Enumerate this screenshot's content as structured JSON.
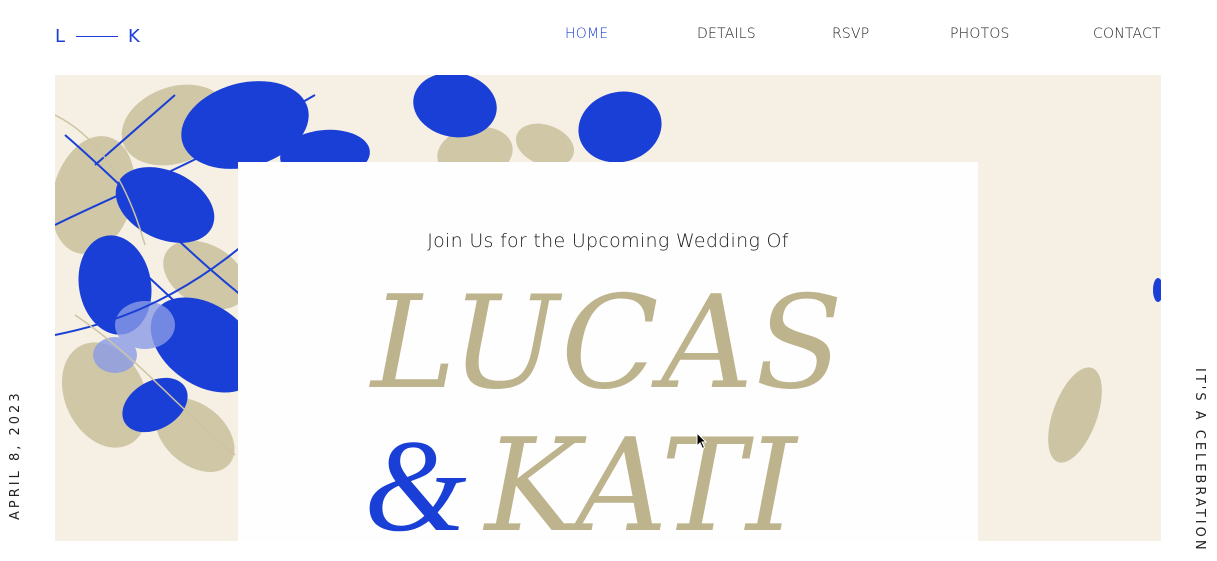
{
  "logo": {
    "left": "L",
    "right": "K"
  },
  "nav": [
    {
      "label": "HOME",
      "active": true
    },
    {
      "label": "DETAILS",
      "active": false
    },
    {
      "label": "RSVP",
      "active": false
    },
    {
      "label": "PHOTOS",
      "active": false
    },
    {
      "label": "CONTACT",
      "active": false
    }
  ],
  "invite": {
    "subtitle": "Join Us for the Upcoming Wedding Of",
    "name1": "LUCAS",
    "ampersand": "&",
    "name2": "KATI"
  },
  "side": {
    "date": "APRIL 8, 2023",
    "tagline": "IT'S A CELEBRATION"
  },
  "colors": {
    "accent": "#1a3fd6",
    "gold": "#bdb38c",
    "cream": "#f6efe3"
  }
}
